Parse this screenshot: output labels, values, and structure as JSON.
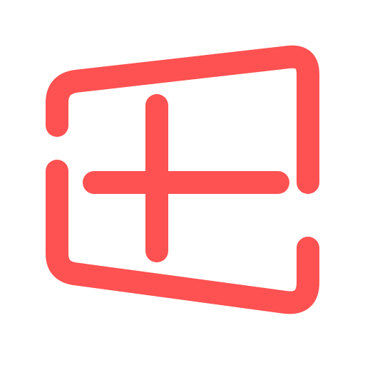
{
  "icon": {
    "name": "windows-add-icon",
    "color": "#fe5151"
  }
}
